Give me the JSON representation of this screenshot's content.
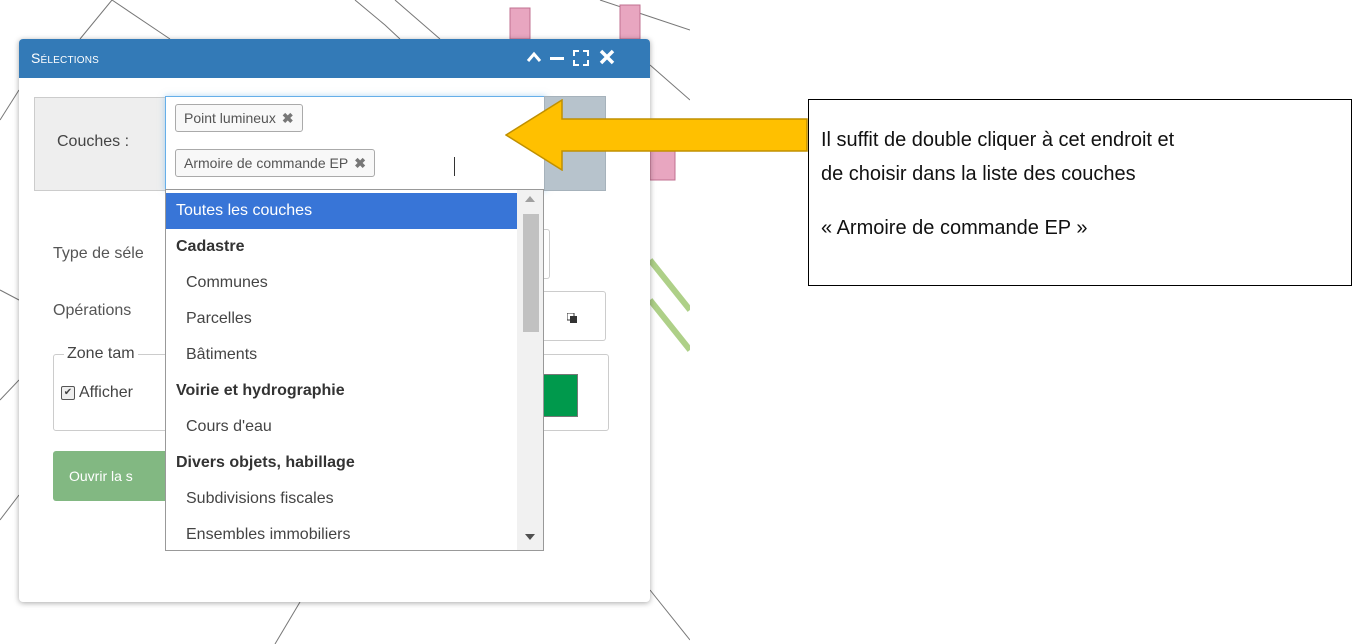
{
  "panel": {
    "title": "Sélections",
    "title_icons": [
      "chevron-up-icon",
      "minimize-icon",
      "expand-icon",
      "close-icon"
    ]
  },
  "layers": {
    "label": "Couches :",
    "tags": [
      {
        "label": "Point lumineux",
        "remove": "✖"
      },
      {
        "label": "Armoire de commande EP",
        "remove": "✖"
      }
    ]
  },
  "form": {
    "selection_type_label": "Type de séle",
    "operations_label": "Opérations",
    "buffer_legend": "Zone tam",
    "show_label": "Afficher",
    "show_checked": true,
    "open_button": "Ouvrir la s",
    "buffer_color": "#00994c"
  },
  "dropdown": {
    "items": [
      {
        "label": "Toutes les couches",
        "kind": "active"
      },
      {
        "label": "Cadastre",
        "kind": "group"
      },
      {
        "label": "Communes",
        "kind": "sub"
      },
      {
        "label": "Parcelles",
        "kind": "sub"
      },
      {
        "label": "Bâtiments",
        "kind": "sub"
      },
      {
        "label": "Voirie et hydrographie",
        "kind": "group"
      },
      {
        "label": "Cours d'eau",
        "kind": "sub"
      },
      {
        "label": "Divers objets, habillage",
        "kind": "group"
      },
      {
        "label": "Subdivisions fiscales",
        "kind": "sub"
      },
      {
        "label": "Ensembles immobiliers",
        "kind": "sub"
      }
    ]
  },
  "callout": {
    "line1": "Il suffit de double cliquer à cet endroit et",
    "line2": "de choisir dans la liste des couches",
    "line3": "« Armoire de commande EP »"
  },
  "colors": {
    "titlebar": "#337ab7",
    "active_item": "#3875d7",
    "arrow": "#ffc000",
    "open_button": "#82b882"
  }
}
